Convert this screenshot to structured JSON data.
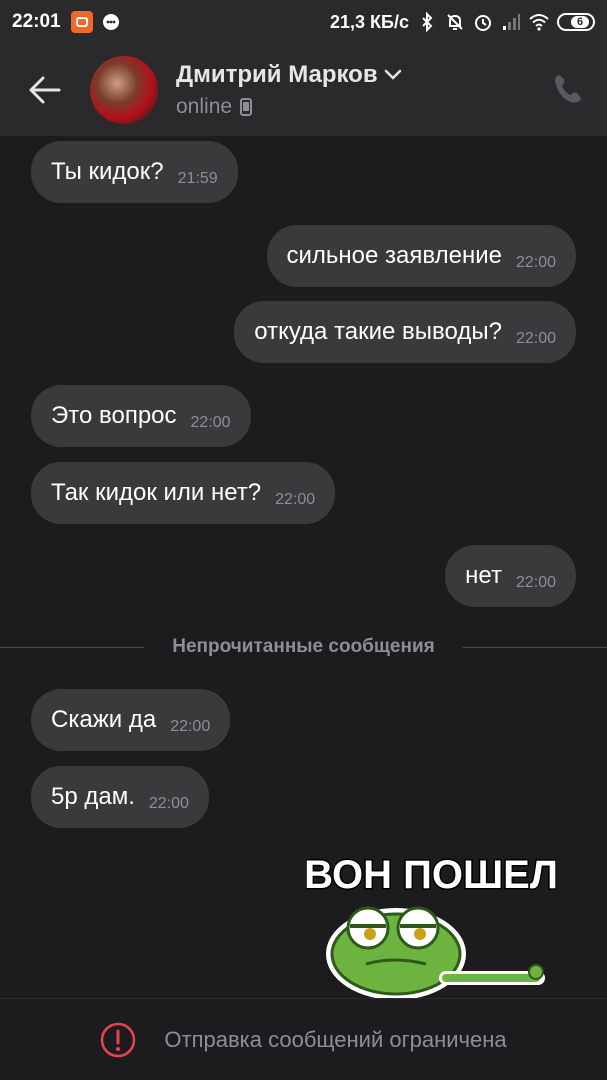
{
  "status_bar": {
    "time": "22:01",
    "network_speed": "21,3 КБ/с",
    "battery_level": "6",
    "icons": [
      "app-notification-icon",
      "chat-notification-icon",
      "bluetooth-icon",
      "mute-icon",
      "alarm-icon",
      "signal-icon",
      "wifi-icon",
      "battery-icon"
    ]
  },
  "header": {
    "contact_name": "Дмитрий Марков",
    "presence": "online",
    "icons": [
      "back-arrow-icon",
      "chevron-down-icon",
      "mobile-device-icon",
      "phone-icon"
    ]
  },
  "messages": [
    {
      "side": "in",
      "text": "Ты кидок?",
      "time": "21:59"
    },
    {
      "side": "out",
      "text": "сильное заявление",
      "time": "22:00"
    },
    {
      "side": "out",
      "text": "откуда такие выводы?",
      "time": "22:00"
    },
    {
      "side": "in",
      "text": "Это вопрос",
      "time": "22:00"
    },
    {
      "side": "in",
      "text": "Так кидок или нет?",
      "time": "22:00"
    },
    {
      "side": "out",
      "text": "нет",
      "time": "22:00"
    },
    {
      "side": "in",
      "text": "Скажи да",
      "time": "22:00"
    },
    {
      "side": "in",
      "text": "5р дам.",
      "time": "22:00"
    }
  ],
  "unread_divider": "Непрочитанные сообщения",
  "sticker": {
    "caption": "ВОН ПОШЕЛ",
    "icon": "frog-sticker"
  },
  "footer": {
    "notice": "Отправка сообщений ограничена",
    "icon": "alert-circle-icon",
    "accent_color": "#e8434f"
  },
  "colors": {
    "background": "#1c1c1e",
    "bar": "#2a2a2c",
    "bubble": "#3a3a3c",
    "secondary_text": "#8e8e93"
  }
}
